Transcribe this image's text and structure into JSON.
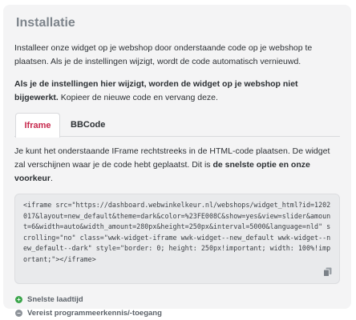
{
  "section": {
    "title": "Installatie",
    "intro": "Installeer onze widget op je webshop door onderstaande code op je webshop te plaatsen. Als je de instellingen wijzigt, wordt de code automatisch vernieuwd.",
    "warning_bold": "Als je de instellingen hier wijzigt, worden de widget op je webshop niet bijgewerkt.",
    "warning_rest": " Kopieer de nieuwe code en vervang deze."
  },
  "tabs": [
    {
      "label": "Iframe",
      "active": true
    },
    {
      "label": "BBCode",
      "active": false
    }
  ],
  "iframe_tab": {
    "desc_start": "Je kunt het onderstaande IFrame rechtstreeks in de HTML-code plaatsen. De widget zal verschijnen waar je de code hebt geplaatst. Dit is ",
    "desc_bold": "de snelste optie en onze voorkeur",
    "desc_end": ".",
    "code": "<iframe src=\"https://dashboard.webwinkelkeur.nl/webshops/widget_html?id=1202017&layout=new_default&theme=dark&color=%23FE008C&show=yes&view=slider&amount=6&width=auto&width_amount=280px&height=250px&interval=5000&language=nld\" scrolling=\"no\" class=\"wwk-widget-iframe wwk-widget--new_default wwk-widget--new_default--dark\" style=\"border: 0; height: 250px!important; width: 100%!important;\"></iframe>"
  },
  "features": [
    {
      "type": "pro",
      "symbol": "+",
      "text": "Snelste laadtijd"
    },
    {
      "type": "con",
      "symbol": "−",
      "text": "Vereist programmeerkennis/-toegang"
    }
  ],
  "colors": {
    "accent": "#c72a4e",
    "pro": "#3aa54a",
    "con": "#8d9299"
  },
  "icons": {
    "copy": "copy-icon",
    "pro": "plus-circle-icon",
    "con": "minus-circle-icon"
  }
}
